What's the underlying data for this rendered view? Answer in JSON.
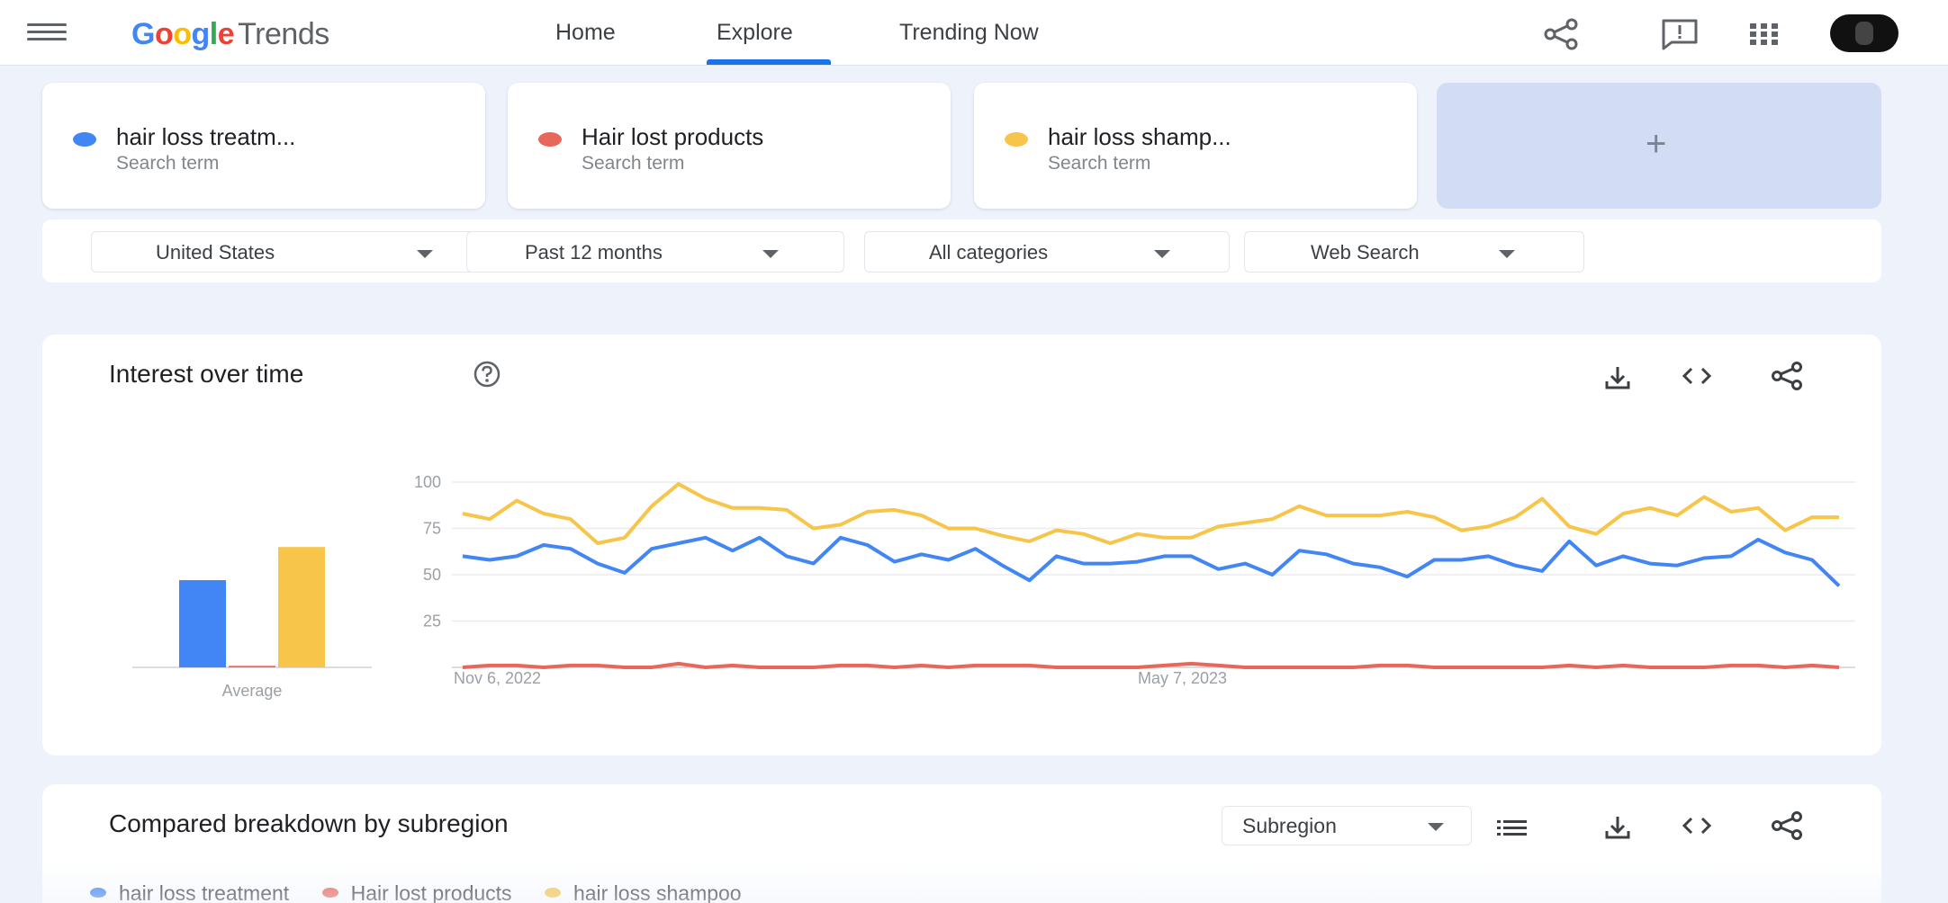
{
  "header": {
    "logo_google": "Google",
    "logo_trends": "Trends",
    "nav": {
      "home": "Home",
      "explore": "Explore",
      "trending": "Trending Now"
    },
    "icons": [
      "menu-icon",
      "share-icon",
      "feedback-icon",
      "apps-icon",
      "avatar"
    ]
  },
  "terms": [
    {
      "label": "hair loss treatm...",
      "sub": "Search term",
      "color": "#4285f4"
    },
    {
      "label": "Hair lost products",
      "sub": "Search term",
      "color": "#e8675a"
    },
    {
      "label": "hair loss shamp...",
      "sub": "Search term",
      "color": "#f6c549"
    }
  ],
  "add_term": "+",
  "filters": {
    "region": "United States",
    "time": "Past 12 months",
    "category": "All categories",
    "search_type": "Web Search"
  },
  "interest": {
    "title": "Interest over time",
    "icons": [
      "help-icon",
      "download-icon",
      "embed-icon",
      "share-icon"
    ]
  },
  "chart_data": [
    {
      "type": "bar",
      "categories": [
        "Average"
      ],
      "series": [
        {
          "values": [
            58
          ],
          "color": "#4285f4"
        },
        {
          "values": [
            1
          ],
          "color": "#e8675a"
        },
        {
          "values": [
            80
          ],
          "color": "#f6c549"
        }
      ],
      "xlabel": "Average",
      "ylim": [
        0,
        100
      ]
    },
    {
      "type": "line",
      "x_tick_labels": [
        "Nov 6, 2022",
        "May 7, 2023"
      ],
      "y_ticks": [
        25,
        50,
        75,
        100
      ],
      "ylim": [
        0,
        100
      ],
      "grid": true,
      "series": [
        {
          "color": "#4285f4",
          "values": [
            60,
            58,
            60,
            66,
            64,
            56,
            51,
            64,
            67,
            70,
            63,
            70,
            60,
            56,
            70,
            66,
            57,
            61,
            58,
            64,
            55,
            47,
            60,
            56,
            56,
            57,
            60,
            60,
            53,
            56,
            50,
            63,
            61,
            56,
            54,
            49,
            58,
            58,
            60,
            55,
            52,
            68,
            55,
            60,
            56,
            55,
            59,
            60,
            69,
            62,
            58,
            44
          ]
        },
        {
          "color": "#e8675a",
          "values": [
            0,
            1,
            1,
            0,
            1,
            1,
            0,
            0,
            2,
            0,
            1,
            0,
            0,
            0,
            1,
            1,
            0,
            1,
            0,
            1,
            1,
            1,
            0,
            0,
            0,
            0,
            1,
            2,
            1,
            0,
            0,
            0,
            0,
            0,
            1,
            1,
            0,
            0,
            0,
            0,
            0,
            1,
            0,
            1,
            0,
            0,
            0,
            1,
            1,
            0,
            1,
            0
          ]
        },
        {
          "color": "#f6c549",
          "values": [
            83,
            80,
            90,
            83,
            80,
            67,
            70,
            87,
            99,
            91,
            86,
            86,
            85,
            75,
            77,
            84,
            85,
            82,
            75,
            75,
            71,
            68,
            74,
            72,
            67,
            72,
            70,
            70,
            76,
            78,
            80,
            87,
            82,
            82,
            82,
            84,
            81,
            74,
            76,
            81,
            91,
            76,
            72,
            83,
            86,
            82,
            92,
            84,
            86,
            74,
            81,
            81
          ]
        }
      ]
    }
  ],
  "subregion": {
    "title": "Compared breakdown by subregion",
    "select": "Subregion",
    "icons": [
      "list-icon",
      "download-icon",
      "embed-icon",
      "share-icon"
    ],
    "legend": [
      {
        "label": "hair loss treatment",
        "color": "#4285f4"
      },
      {
        "label": "Hair lost products",
        "color": "#e8675a"
      },
      {
        "label": "hair loss shampoo",
        "color": "#f6c549"
      }
    ]
  }
}
